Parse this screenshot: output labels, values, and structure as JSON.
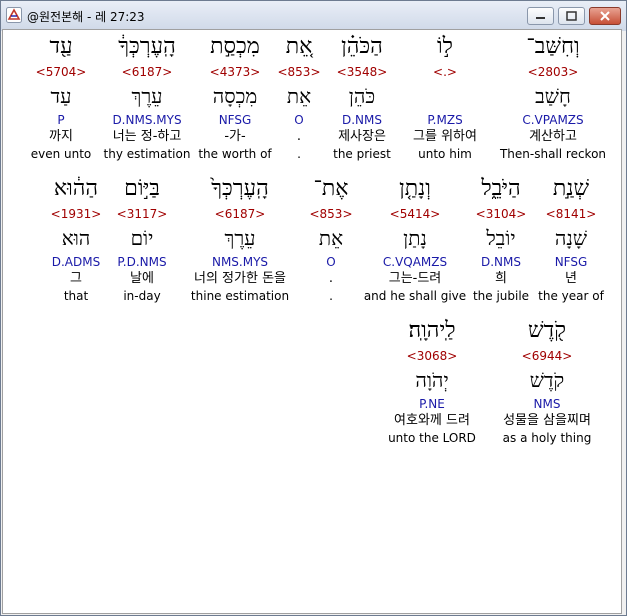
{
  "window": {
    "title": "@원전본해 - 레 27:23"
  },
  "verse": [
    {
      "heb": "וְחִשַּׁב־",
      "strong": "<2803>",
      "lemma": "חָשַׁב",
      "parse": "C.VPAMZS",
      "kor": "계산하고",
      "eng": "Then-shall reckon"
    },
    {
      "heb": "ל֣וֹ",
      "strong": "<.>",
      "lemma": "",
      "parse": "P.MZS",
      "kor": "그를 위하여",
      "eng": "unto him"
    },
    {
      "heb": "הַכֹּהֵ֗ן",
      "strong": "<3548>",
      "lemma": "כֹּהֵן",
      "parse": "D.NMS",
      "kor": "제사장은",
      "eng": "the priest"
    },
    {
      "heb": "אֵ֚ת",
      "strong": "<853>",
      "lemma": "אֵת",
      "parse": "O",
      "kor": ".",
      "eng": "."
    },
    {
      "heb": "מִכְסַ֣ת",
      "strong": "<4373>",
      "lemma": "מִכְסָה",
      "parse": "NFSG",
      "kor": "-가-",
      "eng": "the worth of"
    },
    {
      "heb": "הָֽעֶרְכְּךָ֔",
      "strong": "<6187>",
      "lemma": "עֵרֶךְ",
      "parse": "D.NMS.MYS",
      "kor": "너는 정-하고",
      "eng": "thy estimation"
    },
    {
      "heb": "עַ֖ד",
      "strong": "<5704>",
      "lemma": "עַד",
      "parse": "P",
      "kor": "까지",
      "eng": "even unto"
    },
    {
      "heb": "שְׁנַ֣ת",
      "strong": "<8141>",
      "lemma": "שָׁנָה",
      "parse": "NFSG",
      "kor": "년",
      "eng": "the year of"
    },
    {
      "heb": "הַיֹּבֵ֑ל",
      "strong": "<3104>",
      "lemma": "יוֹבֵל",
      "parse": "D.NMS",
      "kor": "희",
      "eng": "the jubile"
    },
    {
      "heb": "וְנָתַ֤ן",
      "strong": "<5414>",
      "lemma": "נָתַן",
      "parse": "C.VQAMZS",
      "kor": "그는-드려",
      "eng": "and he shall give"
    },
    {
      "heb": "אֶת־",
      "strong": "<853>",
      "lemma": "אֵת",
      "parse": "O",
      "kor": ".",
      "eng": "."
    },
    {
      "heb": "הָֽעֶרְכְּךָ֙",
      "strong": "<6187>",
      "lemma": "עֵרֶךְ",
      "parse": "NMS.MYS",
      "kor": "너의 정가한 돈을",
      "eng": "thine estimation"
    },
    {
      "heb": "בַּיּ֣וֹם",
      "strong": "<3117>",
      "lemma": "יוֹם",
      "parse": "P.D.NMS",
      "kor": "날에",
      "eng": "in-day"
    },
    {
      "heb": "הַה֔וּא",
      "strong": "<1931>",
      "lemma": "הוּא",
      "parse": "D.ADMS",
      "kor": "그",
      "eng": "that"
    },
    {
      "heb": "קֹ֖דֶשׁ",
      "strong": "<6944>",
      "lemma": "קֹדֶשׁ",
      "parse": "NMS",
      "kor": "성물을 삼을찌며",
      "eng": "as a holy thing"
    },
    {
      "heb": "לַֽיהוָֽה׃",
      "strong": "<3068>",
      "lemma": "יְהֹוָה",
      "parse": "P.NE",
      "kor": "여호와께 드려",
      "eng": "unto the LORD"
    }
  ]
}
